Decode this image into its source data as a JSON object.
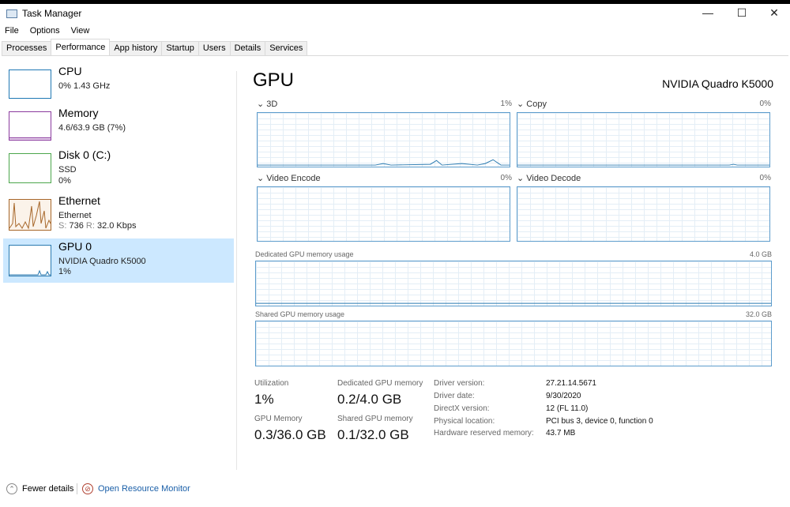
{
  "window": {
    "title": "Task Manager",
    "minimize": "—",
    "maximize": "☐",
    "close": "✕"
  },
  "menu": [
    "File",
    "Options",
    "View"
  ],
  "tabs": [
    "Processes",
    "Performance",
    "App history",
    "Startup",
    "Users",
    "Details",
    "Services"
  ],
  "sidebar": [
    {
      "name": "CPU",
      "line1": "0% 1.43 GHz",
      "color": "#1f78b4"
    },
    {
      "name": "Memory",
      "line1": "4.6/63.9 GB (7%)",
      "color": "#8b3a9e"
    },
    {
      "name": "Disk 0 (C:)",
      "line1": "SSD",
      "line2": "0%",
      "color": "#4ca64c"
    },
    {
      "name": "Ethernet",
      "line1": "Ethernet",
      "line2_s": "S:",
      "line2_sv": "736",
      "line2_r": "R:",
      "line2_rv": "32.0 Kbps",
      "color": "#a7672a"
    },
    {
      "name": "GPU 0",
      "line1": "NVIDIA Quadro K5000",
      "line2": "1%",
      "color": "#2a7ab0"
    }
  ],
  "main": {
    "title": "GPU",
    "device": "NVIDIA Quadro K5000",
    "engines": [
      {
        "label": "3D",
        "pct": "1%"
      },
      {
        "label": "Copy",
        "pct": "0%"
      },
      {
        "label": "Video Encode",
        "pct": "0%"
      },
      {
        "label": "Video Decode",
        "pct": "0%"
      }
    ],
    "dedicated": {
      "label": "Dedicated GPU memory usage",
      "max": "4.0 GB"
    },
    "shared": {
      "label": "Shared GPU memory usage",
      "max": "32.0 GB"
    },
    "stats": {
      "util_label": "Utilization",
      "util": "1%",
      "ded_label": "Dedicated GPU memory",
      "ded": "0.2/4.0 GB",
      "gpumem_label": "GPU Memory",
      "gpumem": "0.3/36.0 GB",
      "shared_label": "Shared GPU memory",
      "shared": "0.1/32.0 GB"
    },
    "info": [
      {
        "k": "Driver version:",
        "v": "27.21.14.5671"
      },
      {
        "k": "Driver date:",
        "v": "9/30/2020"
      },
      {
        "k": "DirectX version:",
        "v": "12 (FL 11.0)"
      },
      {
        "k": "Physical location:",
        "v": "PCI bus 3, device 0, function 0"
      },
      {
        "k": "Hardware reserved memory:",
        "v": "43.7 MB"
      }
    ]
  },
  "footer": {
    "fewer": "Fewer details",
    "monitor": "Open Resource Monitor"
  }
}
